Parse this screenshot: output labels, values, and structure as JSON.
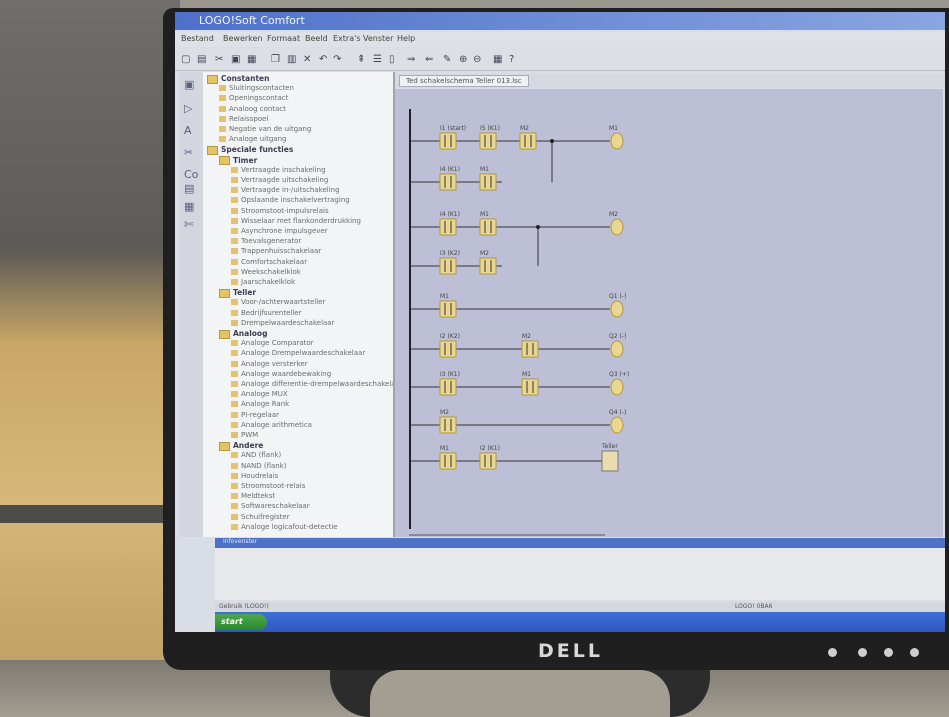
{
  "window": {
    "title": "LOGO!Soft Comfort"
  },
  "menu": [
    "Bestand",
    "Bewerken",
    "Formaat",
    "Beeld",
    "Extra's",
    "Venster",
    "Help"
  ],
  "tab": {
    "label": "Ted schakelschema Teller 013.lsc"
  },
  "tree": [
    {
      "label": "Constanten",
      "level": 0,
      "folder": true
    },
    {
      "label": "Sluitingscontacten",
      "level": 1
    },
    {
      "label": "Openingscontact",
      "level": 1
    },
    {
      "label": "Analoog contact",
      "level": 1
    },
    {
      "label": "Relaisspoel",
      "level": 1
    },
    {
      "label": "Negatie van de uitgang",
      "level": 1
    },
    {
      "label": "Analoge uitgang",
      "level": 1
    },
    {
      "label": "Speciale functies",
      "level": 0,
      "folder": true
    },
    {
      "label": "Timer",
      "level": 1,
      "folder": true
    },
    {
      "label": "Vertraagde inschakeling",
      "level": 2
    },
    {
      "label": "Vertraagde uitschakeling",
      "level": 2
    },
    {
      "label": "Vertraagde in-/uitschakeling",
      "level": 2
    },
    {
      "label": "Opslaande inschakelvertraging",
      "level": 2
    },
    {
      "label": "Stroomstoot-impulsrelais",
      "level": 2
    },
    {
      "label": "Wisselaar met flankonderdrukking",
      "level": 2
    },
    {
      "label": "Asynchrone impulsgever",
      "level": 2
    },
    {
      "label": "Toevalsgenerator",
      "level": 2
    },
    {
      "label": "Trappenhuisschakelaar",
      "level": 2
    },
    {
      "label": "Comfortschakelaar",
      "level": 2
    },
    {
      "label": "Weekschakelklok",
      "level": 2
    },
    {
      "label": "Jaarschakelklok",
      "level": 2
    },
    {
      "label": "Teller",
      "level": 1,
      "folder": true
    },
    {
      "label": "Voor-/achterwaartsteller",
      "level": 2
    },
    {
      "label": "Bedrijfsurenteller",
      "level": 2
    },
    {
      "label": "Drempelwaardeschakelaar",
      "level": 2
    },
    {
      "label": "Analoog",
      "level": 1,
      "folder": true
    },
    {
      "label": "Analoge Comparator",
      "level": 2
    },
    {
      "label": "Analoge Drempelwaardeschakelaar",
      "level": 2
    },
    {
      "label": "Analoge versterker",
      "level": 2
    },
    {
      "label": "Analoge waardebewaking",
      "level": 2
    },
    {
      "label": "Analoge differentie-drempelwaardeschakelaar",
      "level": 2
    },
    {
      "label": "Analoge MUX",
      "level": 2
    },
    {
      "label": "Analoge Rank",
      "level": 2
    },
    {
      "label": "PI-regelaar",
      "level": 2
    },
    {
      "label": "Analoge arithmetica",
      "level": 2
    },
    {
      "label": "PWM",
      "level": 2
    },
    {
      "label": "Andere",
      "level": 1,
      "folder": true
    },
    {
      "label": "AND (flank)",
      "level": 2
    },
    {
      "label": "NAND (flank)",
      "level": 2
    },
    {
      "label": "Houdrelais",
      "level": 2
    },
    {
      "label": "Stroomstoot-relais",
      "level": 2
    },
    {
      "label": "Meldtekst",
      "level": 2
    },
    {
      "label": "Softwareschakelaar",
      "level": 2
    },
    {
      "label": "Schuifregister",
      "level": 2
    },
    {
      "label": "Analoge logicafout-detectie",
      "level": 2
    }
  ],
  "ladder": {
    "rungs": [
      {
        "contacts": [
          "I1 (start)",
          "I5 (K1)",
          "M2"
        ],
        "coil": "M1"
      },
      {
        "contacts": [
          "I4 (K1)",
          "M1"
        ],
        "coil": ""
      },
      {
        "contacts": [
          "I4 (K1)",
          "M1"
        ],
        "coil": "M2"
      },
      {
        "contacts": [
          "I3 (K2)",
          "M2"
        ],
        "coil": ""
      },
      {
        "contacts": [
          "M1"
        ],
        "coil": "Q1 (-)"
      },
      {
        "contacts": [
          "I2 (K2)",
          "M2"
        ],
        "coil": "Q2 (-)"
      },
      {
        "contacts": [
          "I3 (K1)",
          "M1"
        ],
        "coil": "Q3 (+)"
      },
      {
        "contacts": [
          "M2"
        ],
        "coil": "Q4 (-)"
      },
      {
        "contacts": [
          "M1",
          "I2 (K1)"
        ],
        "coil": "Teller",
        "block": true
      }
    ]
  },
  "output_panel": {
    "label": "Infovenster"
  },
  "status": {
    "left": "Gebruik (LOGO!)",
    "right": "LOGO! 0BA6"
  },
  "taskbar": {
    "start": "start"
  },
  "brand": "DELL"
}
